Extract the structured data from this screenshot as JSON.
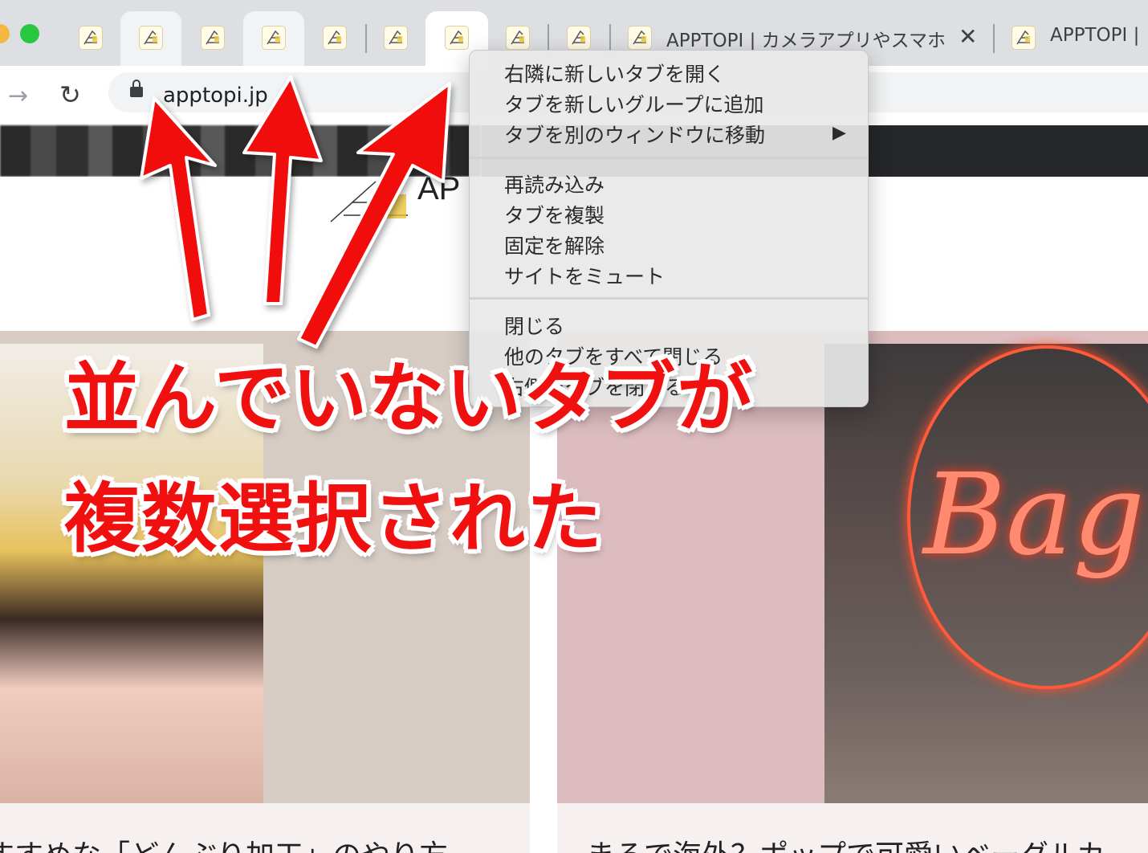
{
  "browser": {
    "tabs": [
      {
        "favicon": "apptopi-favicon-icon",
        "state": "normal"
      },
      {
        "favicon": "apptopi-favicon-icon",
        "state": "selected"
      },
      {
        "favicon": "apptopi-favicon-icon",
        "state": "normal"
      },
      {
        "favicon": "apptopi-favicon-icon",
        "state": "selected"
      },
      {
        "favicon": "apptopi-favicon-icon",
        "state": "normal"
      },
      {
        "favicon": "apptopi-favicon-icon",
        "state": "normal"
      },
      {
        "favicon": "apptopi-favicon-icon",
        "state": "active"
      },
      {
        "favicon": "apptopi-favicon-icon",
        "state": "normal"
      },
      {
        "favicon": "apptopi-favicon-icon",
        "state": "normal"
      },
      {
        "favicon": "apptopi-favicon-icon",
        "state": "normal",
        "title": "APPTOPI | カメラアプリやスマホ"
      },
      {
        "favicon": "apptopi-favicon-icon",
        "state": "normal",
        "title": "APPTOPI |"
      }
    ],
    "tab_close_glyph": "✕",
    "address_bar": {
      "url": "apptopi.jp"
    },
    "nav": {
      "forward_glyph": "→",
      "reload_glyph": "↻"
    }
  },
  "page": {
    "logo_text": "AP",
    "cards": [
      {
        "caption": "すすめな「どんぶり加工」のやり方"
      },
      {
        "caption": "まるで海外？ポップで可愛いベーグルカ",
        "image_text": "Bag"
      }
    ]
  },
  "context_menu": {
    "groups": [
      [
        {
          "label": "右隣に新しいタブを開く"
        },
        {
          "label": "タブを新しいグループに追加"
        },
        {
          "label": "タブを別のウィンドウに移動",
          "submenu_glyph": "▶"
        }
      ],
      [
        {
          "label": "再読み込み"
        },
        {
          "label": "タブを複製"
        },
        {
          "label": "固定を解除"
        },
        {
          "label": "サイトをミュート"
        }
      ],
      [
        {
          "label": "閉じる"
        },
        {
          "label": "他のタブをすべて閉じる"
        },
        {
          "label": "右側のタブを閉じる"
        }
      ]
    ]
  },
  "annotation": {
    "line1": "並んでいないタブが",
    "line2": "複数選択された",
    "color": "#f01010"
  },
  "colors": {
    "tabstrip": "#dedfe3",
    "selected_tab": "#f1f3f4",
    "active_tab": "#ffffff",
    "traffic_yellow": "#f4b73f",
    "traffic_green": "#27c83f"
  }
}
